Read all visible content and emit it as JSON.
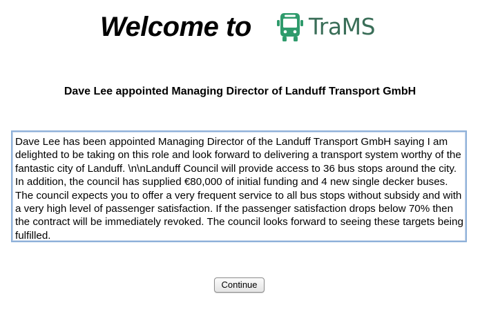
{
  "header": {
    "welcome_text": "Welcome to",
    "logo": {
      "icon": "bus-icon",
      "text": "TraMS",
      "color": "#3a6e58",
      "icon_color": "#2f9b6c"
    }
  },
  "article": {
    "headline": "Dave Lee appointed Managing Director of Landuff Transport GmbH",
    "body": "Dave Lee has been appointed Managing Director of the Landuff Transport GmbH saying I am delighted to be taking on this role and look forward to delivering a transport system worthy of the fantastic city of Landuff. \\n\\nLanduff Council will provide access to 36 bus stops around the city. In addition, the council has supplied €80,000 of initial funding and 4 new single decker buses. The council expects you to offer a very frequent service to all bus stops without subsidy and with a very high level of passenger satisfaction. If the passenger satisfaction drops below 70% then the contract will be immediately revoked. The council looks forward to seeing these targets being fulfilled."
  },
  "actions": {
    "continue_label": "Continue"
  },
  "colors": {
    "box_border": "#8fb1d9"
  }
}
